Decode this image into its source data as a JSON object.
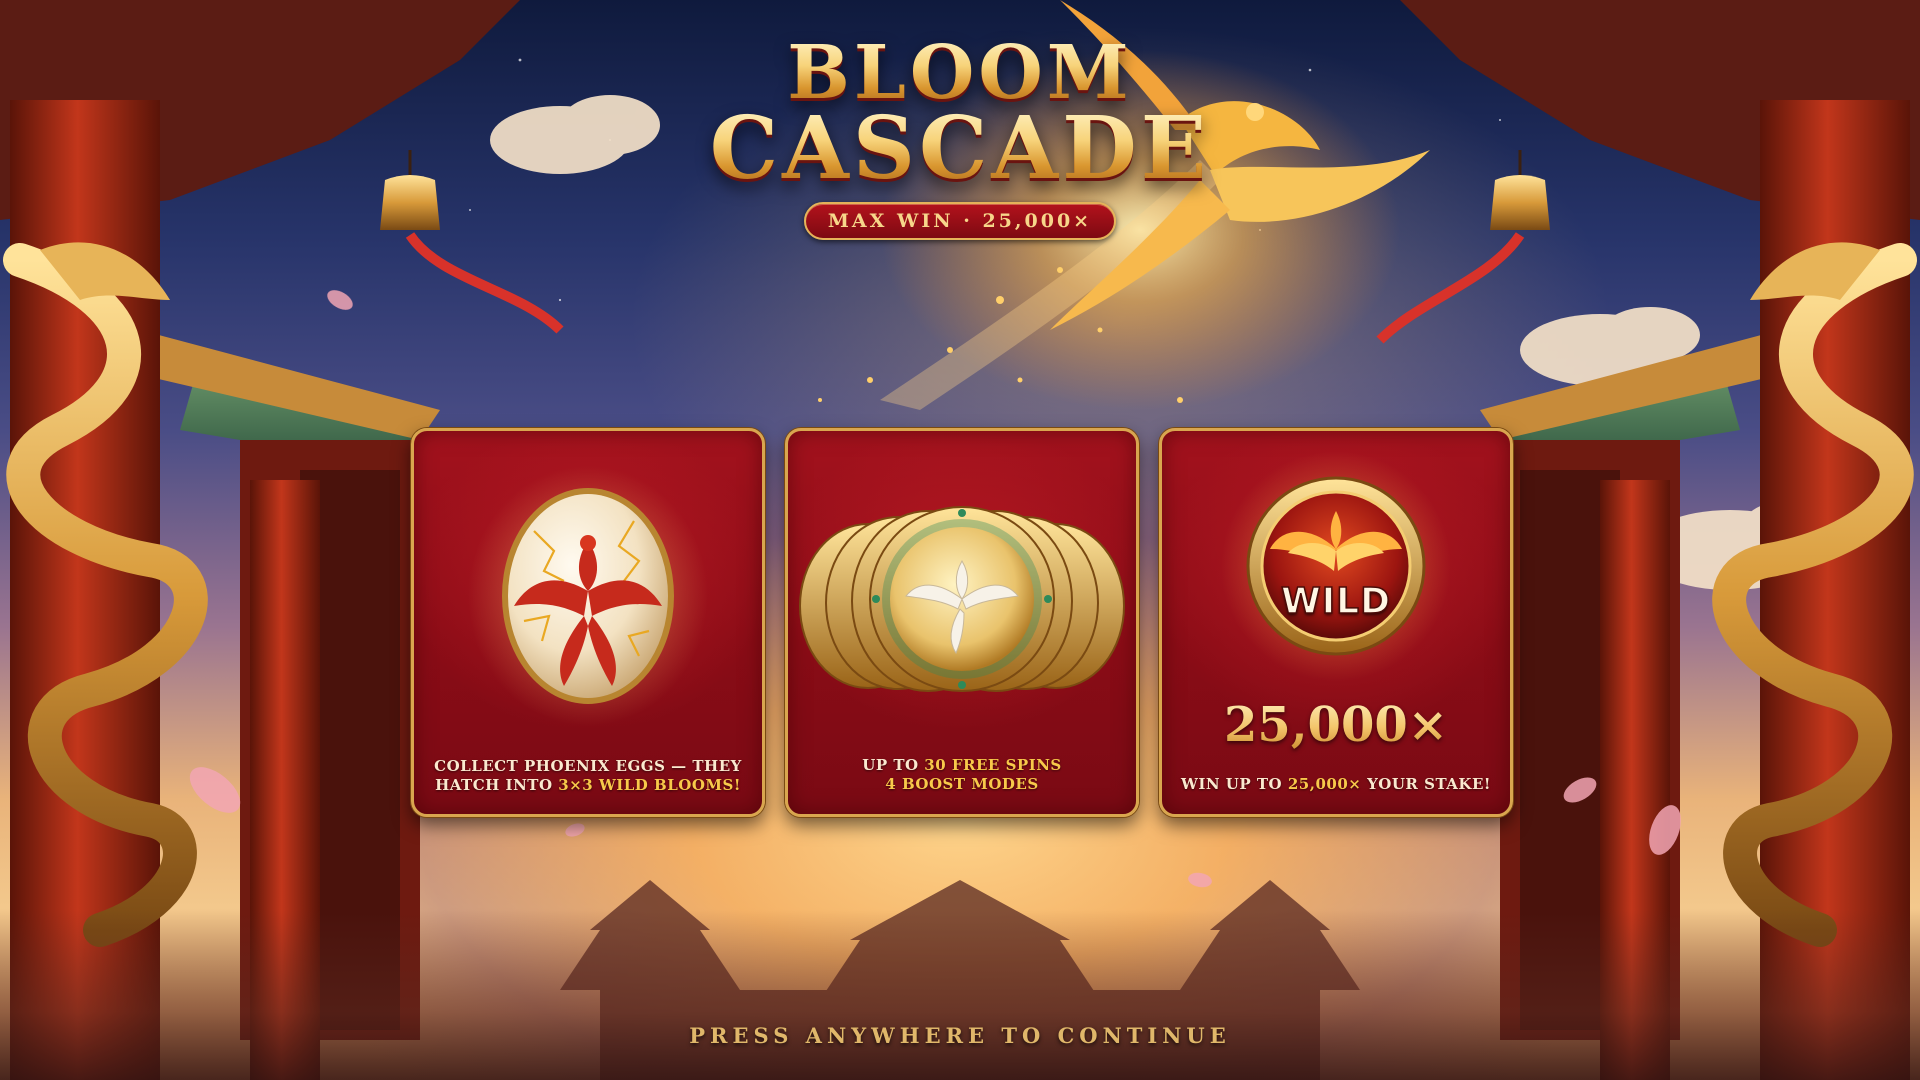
{
  "game": {
    "title_line1": "BLOOM",
    "title_line2": "CASCADE",
    "max_win_badge": "MAX WIN · 25,000×"
  },
  "cards": [
    {
      "icon": "phoenix-egg-icon",
      "text_line1": "COLLECT PHOENIX EGGS — THEY",
      "text_line2_prefix": "HATCH INTO ",
      "text_line2_highlight": "3×3 WILD BLOOMS!"
    },
    {
      "icon": "phoenix-coins-icon",
      "text_line1_prefix": "UP TO ",
      "text_line1_highlight": "30 FREE SPINS",
      "text_line2_highlight": "4 BOOST MODES"
    },
    {
      "icon": "wild-phoenix-medallion-icon",
      "medallion_label": "WILD",
      "multiplier": "25,000×",
      "text_prefix": "WIN UP TO ",
      "text_highlight": "25,000×",
      "text_suffix": " YOUR STAKE!"
    }
  ],
  "footer": {
    "continue_prompt": "PRESS ANYWHERE TO CONTINUE"
  },
  "colors": {
    "card_red": "#8a0c16",
    "card_border_gold": "#d9a64f",
    "highlight_gold": "#f8c94a",
    "title_gold": "#f6d98a",
    "badge_red": "#b3121c"
  }
}
